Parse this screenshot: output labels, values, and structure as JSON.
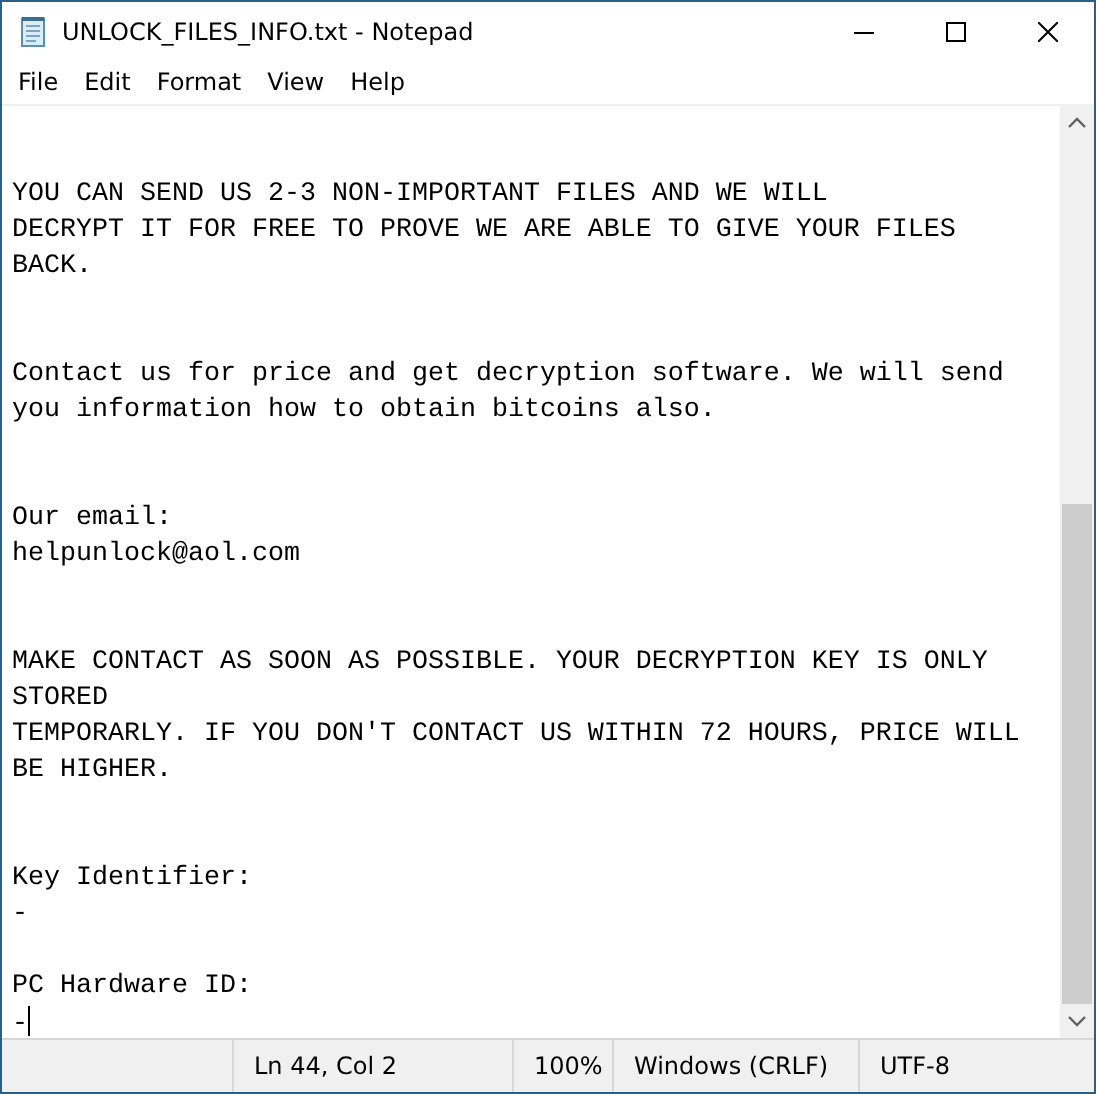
{
  "window": {
    "title": "UNLOCK_FILES_INFO.txt - Notepad"
  },
  "menu": [
    "File",
    "Edit",
    "Format",
    "View",
    "Help"
  ],
  "editor": {
    "content": "\n\nYOU CAN SEND US 2-3 NON-IMPORTANT FILES AND WE WILL\nDECRYPT IT FOR FREE TO PROVE WE ARE ABLE TO GIVE YOUR FILES\nBACK.\n\n\nContact us for price and get decryption software. We will send\nyou information how to obtain bitcoins also.\n\n\nOur email:\nhelpunlock@aol.com\n\n\nMAKE CONTACT AS SOON AS POSSIBLE. YOUR DECRYPTION KEY IS ONLY\nSTORED\nTEMPORARLY. IF YOU DON'T CONTACT US WITHIN 72 HOURS, PRICE WILL\nBE HIGHER.\n\n\nKey Identifier:\n-\n\nPC Hardware ID:\n-"
  },
  "status_bar": {
    "position": "Ln 44, Col 2",
    "zoom": "100%",
    "line_endings": "Windows (CRLF)",
    "encoding": "UTF-8"
  }
}
